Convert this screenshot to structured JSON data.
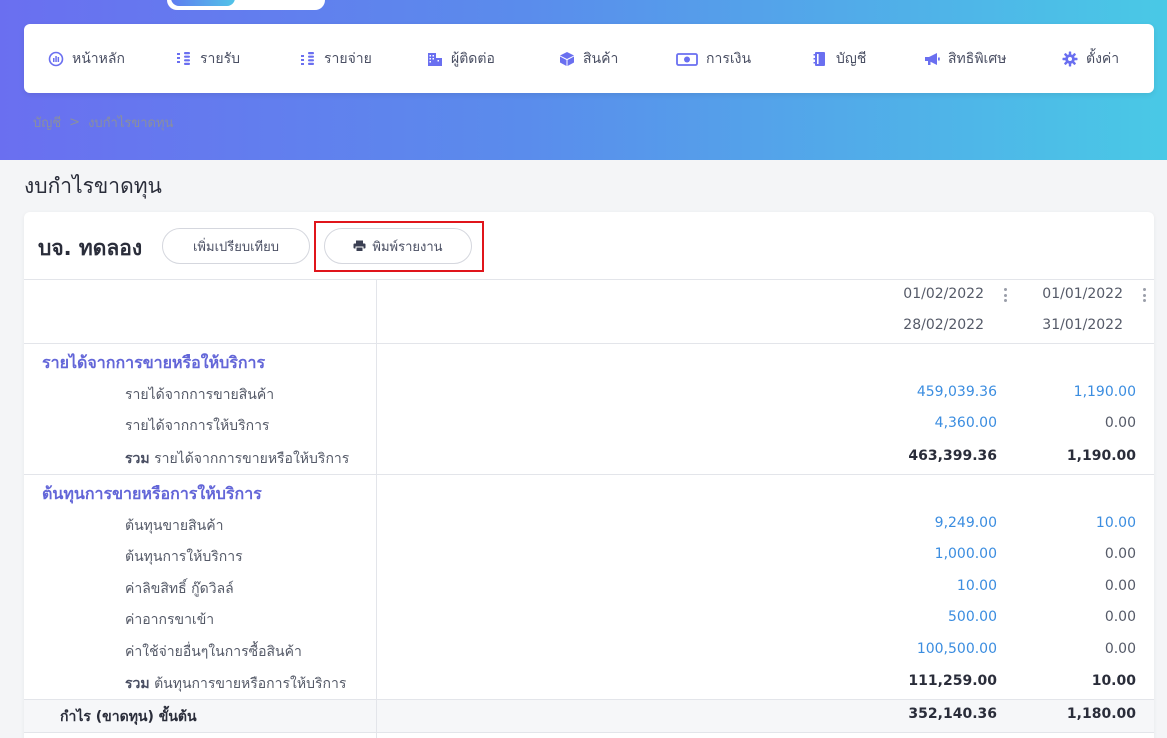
{
  "nav": {
    "items": [
      {
        "label": "หน้าหลัก",
        "icon": "chart-circle-icon"
      },
      {
        "label": "รายรับ",
        "icon": "coins-up-icon"
      },
      {
        "label": "รายจ่าย",
        "icon": "coins-down-icon"
      },
      {
        "label": "ผู้ติดต่อ",
        "icon": "building-icon"
      },
      {
        "label": "สินค้า",
        "icon": "box-icon"
      },
      {
        "label": "การเงิน",
        "icon": "money-icon"
      },
      {
        "label": "บัญชี",
        "icon": "ledger-icon"
      },
      {
        "label": "สิทธิพิเศษ",
        "icon": "megaphone-icon"
      },
      {
        "label": "ตั้งค่า",
        "icon": "gear-icon"
      }
    ]
  },
  "breadcrumb": {
    "parent": "บัญชี",
    "separator": ">",
    "current": "งบกำไรขาดทุน"
  },
  "page_title": "งบกำไรขาดทุน",
  "company": "บจ. ทดลอง",
  "buttons": {
    "compare": "เพิ่มเปรียบเทียบ",
    "print": "พิมพ์รายงาน"
  },
  "periods": [
    {
      "start": "01/02/2022",
      "end": "28/02/2022"
    },
    {
      "start": "01/01/2022",
      "end": "31/01/2022"
    }
  ],
  "revenue": {
    "title": "รายได้จากการขายหรือให้บริการ",
    "rows": [
      {
        "label": "รายได้จากการขายสินค้า",
        "v1": "459,039.36",
        "v2": "1,190.00"
      },
      {
        "label": "รายได้จากการให้บริการ",
        "v1": "4,360.00",
        "v2": "0.00"
      }
    ],
    "total_prefix": "รวม",
    "total_label": "รายได้จากการขายหรือให้บริการ",
    "total_v1": "463,399.36",
    "total_v2": "1,190.00"
  },
  "cost": {
    "title": "ต้นทุนการขายหรือการให้บริการ",
    "rows": [
      {
        "label": "ต้นทุนขายสินค้า",
        "v1": "9,249.00",
        "v2": "10.00"
      },
      {
        "label": "ต้นทุนการให้บริการ",
        "v1": "1,000.00",
        "v2": "0.00"
      },
      {
        "label": "ค่าลิขสิทธิ์ กู๊ดวิลล์",
        "v1": "10.00",
        "v2": "0.00"
      },
      {
        "label": "ค่าอากรขาเข้า",
        "v1": "500.00",
        "v2": "0.00"
      },
      {
        "label": "ค่าใช้จ่ายอื่นๆในการซื้อสินค้า",
        "v1": "100,500.00",
        "v2": "0.00"
      }
    ],
    "total_prefix": "รวม",
    "total_label": "ต้นทุนการขายหรือการให้บริการ",
    "total_v1": "111,259.00",
    "total_v2": "10.00"
  },
  "gross": {
    "label": "กำไร (ขาดทุน) ขั้นต้น",
    "v1": "352,140.36",
    "v2": "1,180.00"
  },
  "colors": {
    "accent": "#6366d8",
    "link": "#3b8de0",
    "highlight": "#e0151b"
  }
}
